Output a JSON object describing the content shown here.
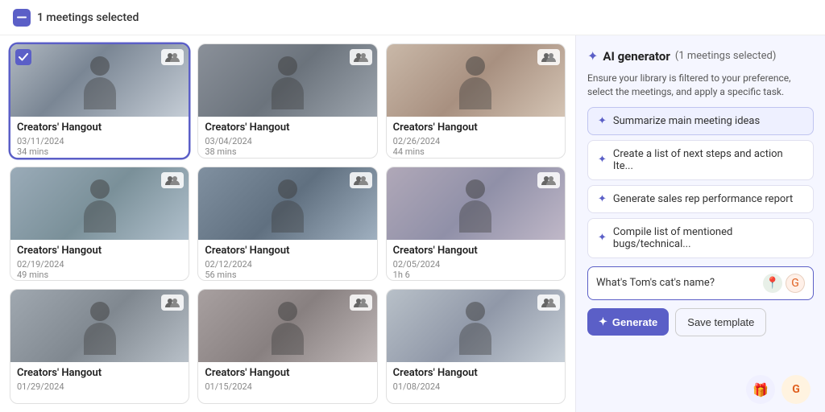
{
  "header": {
    "selected_label": "1 meetings selected"
  },
  "meetings": [
    {
      "id": 1,
      "title": "Creators' Hangout",
      "date": "03/11/2024",
      "duration": "34 mins",
      "selected": true,
      "thumb": "thumb-1"
    },
    {
      "id": 2,
      "title": "Creators' Hangout",
      "date": "03/04/2024",
      "duration": "38 mins",
      "selected": false,
      "thumb": "thumb-2"
    },
    {
      "id": 3,
      "title": "Creators' Hangout",
      "date": "02/26/2024",
      "duration": "44 mins",
      "selected": false,
      "thumb": "thumb-3"
    },
    {
      "id": 4,
      "title": "Creators' Hangout",
      "date": "02/19/2024",
      "duration": "49 mins",
      "selected": false,
      "thumb": "thumb-4"
    },
    {
      "id": 5,
      "title": "Creators' Hangout",
      "date": "02/12/2024",
      "duration": "56 mins",
      "selected": false,
      "thumb": "thumb-5"
    },
    {
      "id": 6,
      "title": "Creators' Hangout",
      "date": "02/05/2024",
      "duration": "1h 6",
      "selected": false,
      "thumb": "thumb-6"
    },
    {
      "id": 7,
      "title": "Creators' Hangout",
      "date": "01/29/2024",
      "duration": "",
      "selected": false,
      "thumb": "thumb-7"
    },
    {
      "id": 8,
      "title": "Creators' Hangout",
      "date": "01/15/2024",
      "duration": "",
      "selected": false,
      "thumb": "thumb-8"
    },
    {
      "id": 9,
      "title": "Creators' Hangout",
      "date": "01/08/2024",
      "duration": "",
      "selected": false,
      "thumb": "thumb-9"
    }
  ],
  "ai_panel": {
    "title": "AI generator",
    "selected_count_label": "(1 meetings selected)",
    "description": "Ensure your library is filtered to your preference, select the meetings, and apply a specific task.",
    "suggestions": [
      {
        "label": "Summarize main meeting ideas"
      },
      {
        "label": "Create a list of next steps and action Ite..."
      },
      {
        "label": "Generate sales rep performance report"
      },
      {
        "label": "Compile list of mentioned bugs/technical..."
      }
    ],
    "input_placeholder": "What's Tom's cat's name?",
    "input_value": "What's Tom's cat's name?",
    "generate_label": "Generate",
    "save_template_label": "Save template"
  },
  "bottom_icons": {
    "gift_icon": "🎁",
    "g_icon": "G"
  }
}
